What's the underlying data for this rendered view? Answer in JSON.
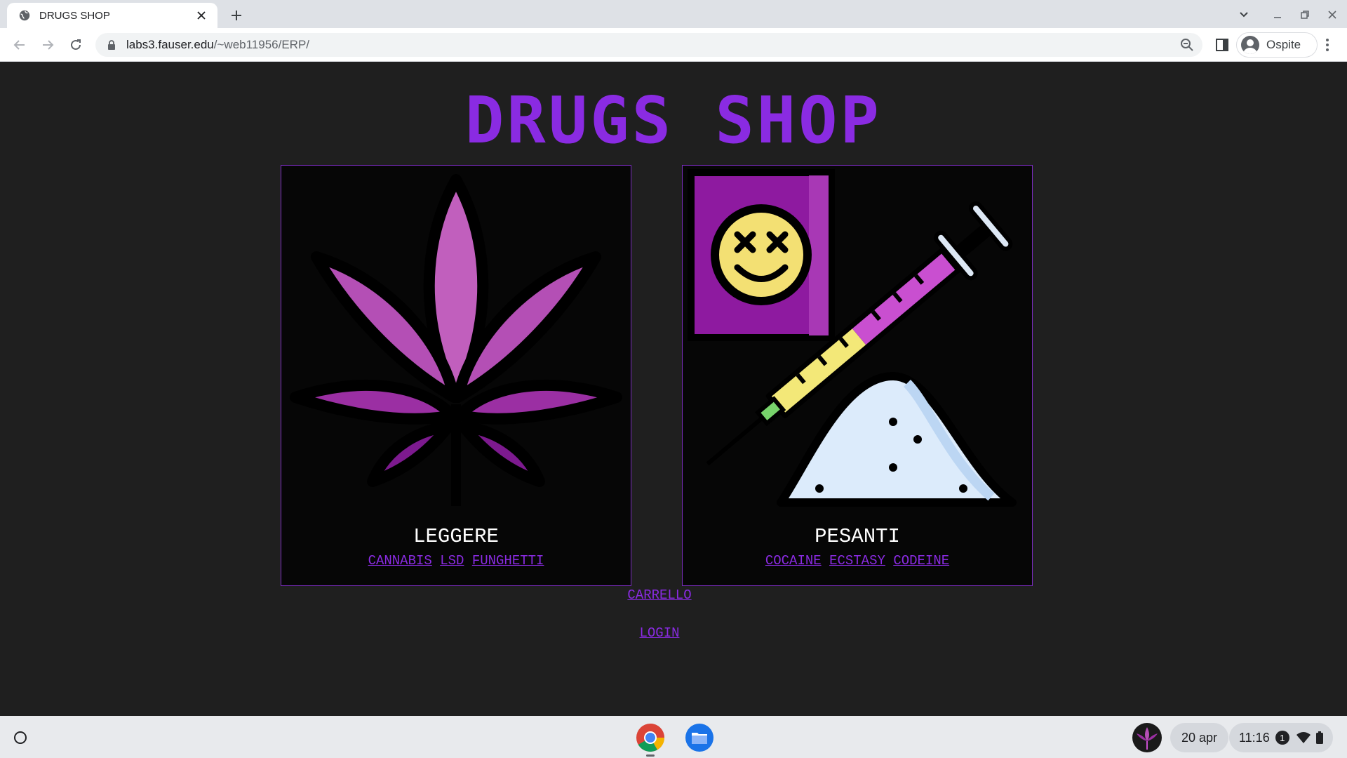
{
  "browser": {
    "tab_title": "DRUGS SHOP",
    "url_host": "labs3.fauser.edu",
    "url_path": "/~web11956/ERP/",
    "profile_label": "Ospite"
  },
  "page": {
    "logo_text": "DRUGS SHOP",
    "accent_color": "#8a2be2",
    "categories": [
      {
        "title": "LEGGERE",
        "links": [
          "CANNABIS",
          "LSD",
          "FUNGHETTI"
        ]
      },
      {
        "title": "PESANTI",
        "links": [
          "COCAINE",
          "ECSTASY",
          "CODEINE"
        ]
      }
    ],
    "cart_label": "CARRELLO",
    "login_label": "LOGIN"
  },
  "shelf": {
    "date": "20 apr",
    "time": "11:16",
    "notification_count": "1",
    "apps": [
      "chrome-icon",
      "files-icon"
    ]
  }
}
